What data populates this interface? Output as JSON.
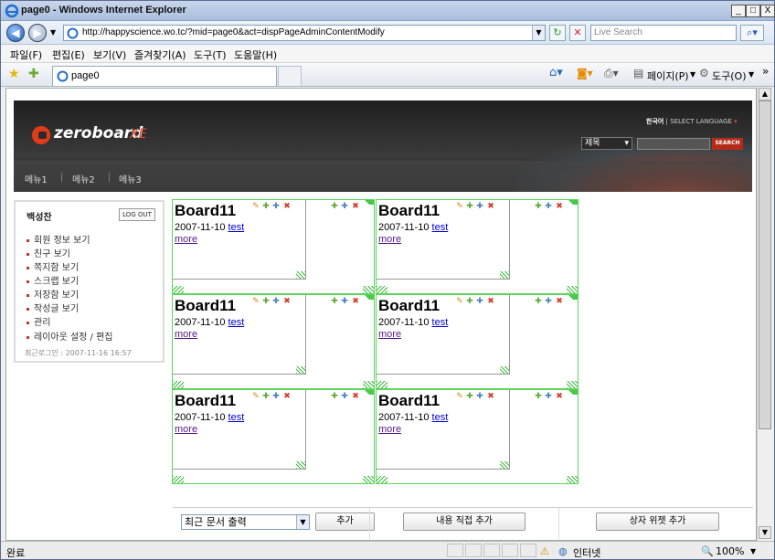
{
  "window": {
    "title": "page0 - Windows Internet Explorer",
    "minimize": "_",
    "maximize": "□",
    "close": "X"
  },
  "address": {
    "url": "http://happyscience.wo.tc/?mid=page0&act=dispPageAdminContentModify",
    "search_placeholder": "Live Search"
  },
  "menu": [
    "파일(F)",
    "편집(E)",
    "보기(V)",
    "즐겨찾기(A)",
    "도구(T)",
    "도움말(H)"
  ],
  "tab": {
    "label": "page0"
  },
  "toolbar": {
    "page_label": "페이지(P)",
    "tools_label": "도구(O)",
    "more": "»"
  },
  "site": {
    "logo_text": "zeroboard",
    "logo_suffix": "XE",
    "lang_current": "한국어",
    "lang_select": "SELECT LANGUAGE",
    "search_option": "제목",
    "search_button": "SEARCH",
    "nav": [
      "메뉴1",
      "메뉴2",
      "메뉴3"
    ]
  },
  "login": {
    "user_name": "백성찬",
    "logout_label": "LOG OUT",
    "items": [
      "회원 정보 보기",
      "친구 보기",
      "쪽지함 보기",
      "스크랩 보기",
      "저장함 보기",
      "작성글 보기",
      "관리",
      "레이아웃 설정 / 편집"
    ],
    "last_login": "최근로그인 : 2007-11-16 16:57"
  },
  "widgets": [
    {
      "title": "Board11",
      "date": "2007-11-10",
      "link": "test",
      "more": "more"
    },
    {
      "title": "Board11",
      "date": "2007-11-10",
      "link": "test",
      "more": "more"
    },
    {
      "title": "Board11",
      "date": "2007-11-10",
      "link": "test",
      "more": "more"
    },
    {
      "title": "Board11",
      "date": "2007-11-10",
      "link": "test",
      "more": "more"
    },
    {
      "title": "Board11",
      "date": "2007-11-10",
      "link": "test",
      "more": "more"
    },
    {
      "title": "Board11",
      "date": "2007-11-10",
      "link": "test",
      "more": "more"
    }
  ],
  "bottom": {
    "select_value": "최근 문서 출력",
    "add_button": "추가",
    "direct_add_button": "내용 직접 추가",
    "box_widget_button": "상자 위젯 추가"
  },
  "status": {
    "text": "완료",
    "zone": "인터넷",
    "zoom": "100%"
  },
  "colors": {
    "widget_border": "#5bd65b",
    "brand_red": "#e23b1a",
    "link": "#0000cc"
  }
}
